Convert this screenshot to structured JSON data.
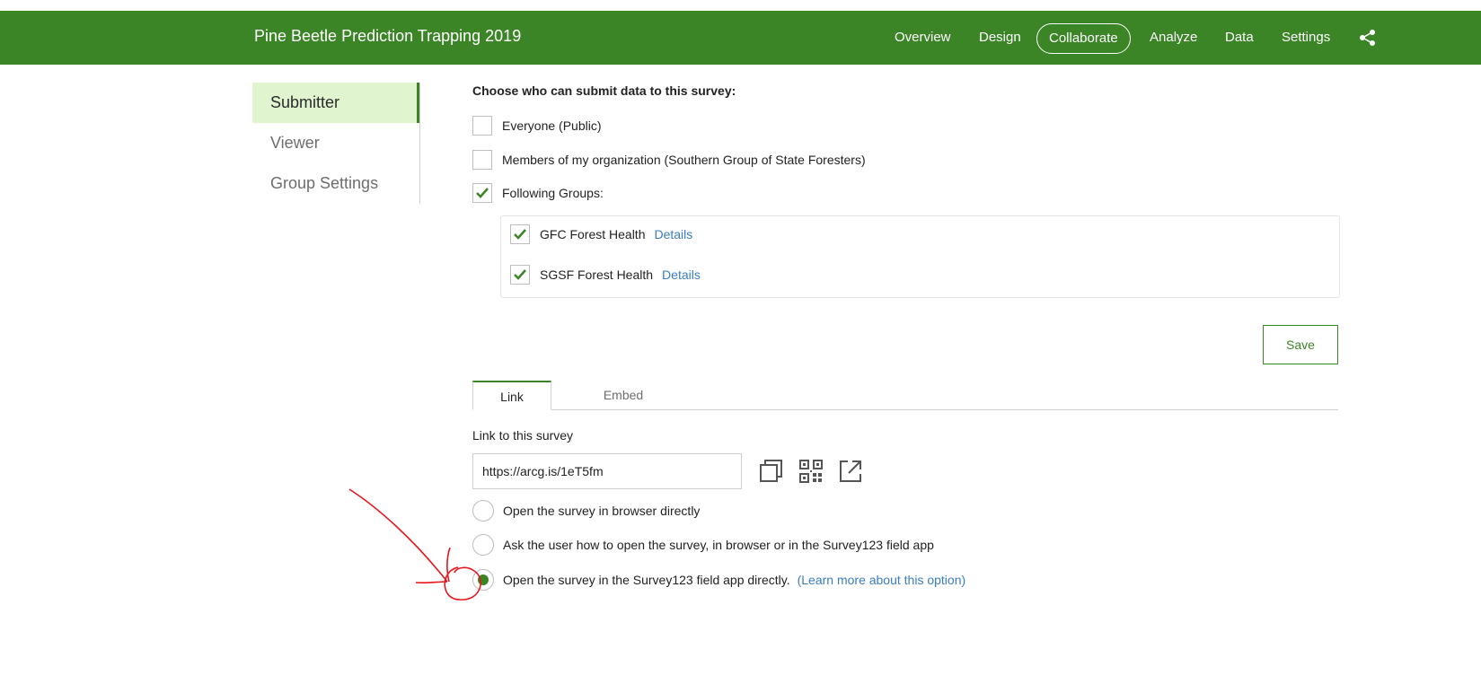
{
  "header": {
    "title": "Pine Beetle Prediction Trapping 2019",
    "nav": [
      {
        "label": "Overview",
        "active": false
      },
      {
        "label": "Design",
        "active": false
      },
      {
        "label": "Collaborate",
        "active": true
      },
      {
        "label": "Analyze",
        "active": false
      },
      {
        "label": "Data",
        "active": false
      },
      {
        "label": "Settings",
        "active": false
      }
    ],
    "share_icon": "share-icon"
  },
  "sidebar": {
    "items": [
      {
        "label": "Submitter",
        "active": true
      },
      {
        "label": "Viewer",
        "active": false
      },
      {
        "label": "Group Settings",
        "active": false
      }
    ]
  },
  "submit": {
    "title": "Choose who can submit data to this survey:",
    "options": [
      {
        "label": "Everyone (Public)",
        "checked": false
      },
      {
        "label": "Members of my organization (Southern Group of State Foresters)",
        "checked": false
      },
      {
        "label": "Following Groups:",
        "checked": true
      }
    ],
    "groups": [
      {
        "label": "GFC Forest Health",
        "checked": true,
        "details": "Details"
      },
      {
        "label": "SGSF Forest Health",
        "checked": true,
        "details": "Details"
      }
    ],
    "save_label": "Save"
  },
  "share": {
    "tabs": [
      {
        "label": "Link",
        "active": true
      },
      {
        "label": "Embed",
        "active": false
      }
    ],
    "link_label": "Link to this survey",
    "link_value": "https://arcg.is/1eT5fm",
    "icons": [
      "copy-icon",
      "qr-code-icon",
      "open-external-icon"
    ],
    "open_options": [
      {
        "label": "Open the survey in browser directly",
        "selected": false
      },
      {
        "label": "Ask the user how to open the survey, in browser or in the Survey123 field app",
        "selected": false
      },
      {
        "label": "Open the survey in the Survey123 field app directly.",
        "selected": true,
        "link": "(Learn more about this option)"
      }
    ]
  },
  "colors": {
    "brand_green": "#3b8527",
    "active_side_bg": "#dff4cf",
    "link_blue": "#3a7dc2",
    "annotation_red": "#e8141b"
  }
}
